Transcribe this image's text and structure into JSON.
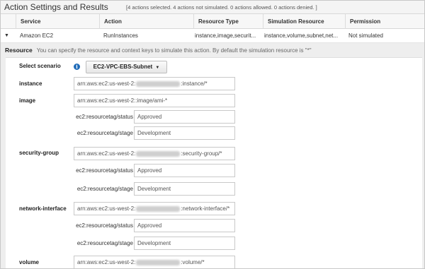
{
  "header": {
    "title": "Action Settings and Results",
    "summary": "[4 actions selected. 4 actions not simulated. 0 actions allowed. 0 actions denied. ]"
  },
  "table": {
    "columns": [
      "Service",
      "Action",
      "Resource Type",
      "Simulation Resource",
      "Permission"
    ],
    "row": {
      "expand_icon": "caret-down-icon",
      "service": "Amazon EC2",
      "action": "RunInstances",
      "resource_type": "instance,image,securit...",
      "simulation_resource": "instance,volume,subnet,net...",
      "permission": "Not simulated"
    }
  },
  "resource_section": {
    "label": "Resource",
    "description": "You can specify the resource and context keys to simulate this action. By default the simulation resource is \"*\""
  },
  "scenario": {
    "label": "Select scenario",
    "info_icon": "info-icon",
    "selected": "EC2-VPC-EBS-Subnet"
  },
  "resources": {
    "instance": {
      "label": "instance",
      "arn_prefix": "arn:aws:ec2:us-west-2:",
      "arn_suffix": ":instance/*"
    },
    "image": {
      "label": "image",
      "arn": "arn:aws:ec2:us-west-2::image/ami-*",
      "status_key": "ec2:resourcetag/status",
      "status_value": "Approved",
      "stage_key": "ec2:resourcetag/stage",
      "stage_value": "Development"
    },
    "security_group": {
      "label": "security-group",
      "arn_prefix": "arn:aws:ec2:us-west-2:",
      "arn_suffix": ":security-group/*",
      "status_key": "ec2:resourcetag/status",
      "status_value": "Approved",
      "stage_key": "ec2:resourcetag/stage",
      "stage_value": "Development"
    },
    "network_interface": {
      "label": "network-interface",
      "arn_prefix": "arn:aws:ec2:us-west-2:",
      "arn_suffix": ":network-interface/*",
      "status_key": "ec2:resourcetag/status",
      "status_value": "Approved",
      "stage_key": "ec2:resourcetag/stage",
      "stage_value": "Development"
    },
    "volume": {
      "label": "volume",
      "arn_prefix": "arn:aws:ec2:us-west-2:",
      "arn_suffix": ":volume/*"
    }
  },
  "colors": {
    "accent_blue": "#1f6bb8",
    "panel_gray": "#eeeeee",
    "border_gray": "#c9c9c9"
  }
}
